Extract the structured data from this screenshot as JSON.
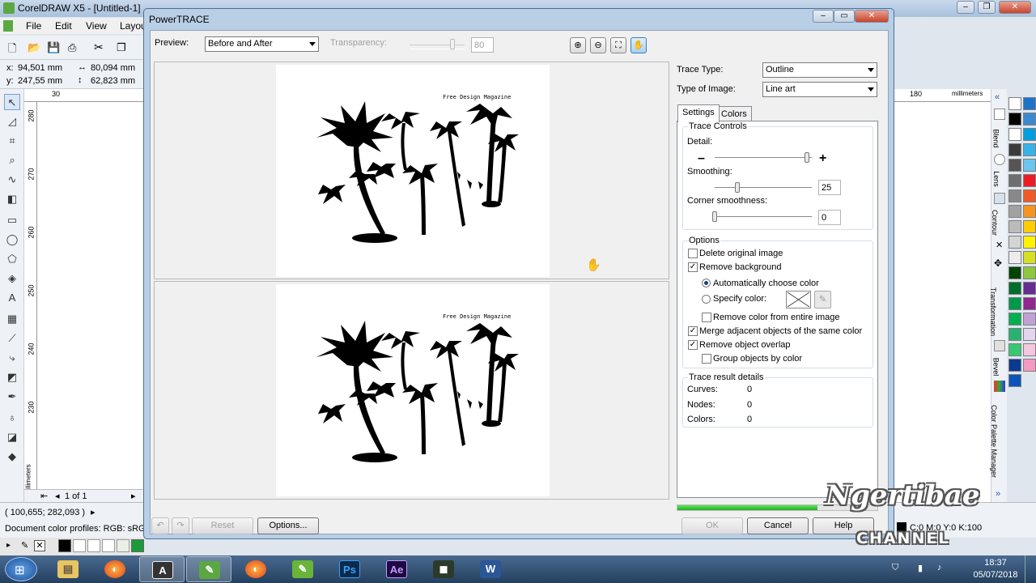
{
  "corel": {
    "title": "CorelDRAW X5 - [Untitled-1]",
    "menu": [
      "File",
      "Edit",
      "View",
      "Layou"
    ],
    "x_label": "x:",
    "x_value": "94,501 mm",
    "y_label": "y:",
    "y_value": "247,55 mm",
    "w_value": "80,094 mm",
    "h_value": "62,823 mm",
    "ruler_top": [
      "30",
      "180"
    ],
    "ruler_units": "millimeters",
    "ruler_left": [
      "280",
      "270",
      "260",
      "250",
      "240",
      "230"
    ],
    "ruler_left_units": "millimeters",
    "page_indicator": "1 of 1",
    "cursor_coords": "( 100,655; 282,093 )",
    "color_profile": "Document color profiles: RGB: sRGB IE",
    "fill_status": "C:0 M:0 Y:0 K:100",
    "dockers": [
      "Blend",
      "Lens",
      "Contour",
      "Transformation",
      "Bevel",
      "Color Palette Manager"
    ],
    "palette": [
      "#ffffff",
      "#000000",
      "#ffffff",
      "#3b3b3b",
      "#555555",
      "#6f6f6f",
      "#888888",
      "#a1a1a1",
      "#bbbbbb",
      "#d4d4d4",
      "#ececec",
      "#004400",
      "#006d2c",
      "#00984a",
      "#00b050",
      "#27b36f",
      "#37c871",
      "#0a3b8f",
      "#0b55b9",
      "#1e73c8",
      "#3b8ad1",
      "#00a0e0",
      "#38b3e8",
      "#6dc4ee",
      "#ed1c24",
      "#f15a24",
      "#f7941d",
      "#ffcc00",
      "#fff200",
      "#d7df23",
      "#8dc63f",
      "#662d91",
      "#92278f",
      "#c2a0d4",
      "#e4d4ef",
      "#f5c6dd",
      "#f49ac1"
    ]
  },
  "dialog": {
    "title": "PowerTRACE",
    "preview_label": "Preview:",
    "preview_value": "Before and After",
    "transparency_label": "Transparency:",
    "transparency_value": "80",
    "magazine_text": "Free Design Magazine",
    "trace_type_label": "Trace Type:",
    "trace_type_value": "Outline",
    "image_type_label": "Type of Image:",
    "image_type_value": "Line art",
    "tabs": [
      "Settings",
      "Colors"
    ],
    "trace_controls_title": "Trace Controls",
    "detail_label": "Detail:",
    "detail_level": 0.95,
    "smoothing_label": "Smoothing:",
    "smoothing_value": "25",
    "corner_label": "Corner smoothness:",
    "corner_value": "0",
    "options_title": "Options",
    "delete_original": "Delete original image",
    "delete_original_checked": false,
    "remove_background": "Remove background",
    "remove_background_checked": true,
    "auto_color": "Automatically choose color",
    "auto_color_selected": true,
    "specify_color": "Specify color:",
    "specify_color_selected": false,
    "remove_entire": "Remove color from entire image",
    "remove_entire_checked": false,
    "merge_adjacent": "Merge adjacent objects of the same color",
    "merge_adjacent_checked": true,
    "remove_overlap": "Remove object overlap",
    "remove_overlap_checked": true,
    "group_by_color": "Group objects by color",
    "group_by_color_checked": false,
    "result_title": "Trace result details",
    "curves_label": "Curves:",
    "curves_value": "0",
    "nodes_label": "Nodes:",
    "nodes_value": "0",
    "colors_label": "Colors:",
    "colors_value": "0",
    "progress": 0.7,
    "reset_label": "Reset",
    "options_label": "Options...",
    "ok_label": "OK",
    "cancel_label": "Cancel",
    "help_label": "Help"
  },
  "taskbar": {
    "time": "18:37",
    "date": "05/07/2018",
    "apps": [
      "windows-start",
      "file-explorer",
      "firefox",
      "coreldraw-a",
      "coreldraw-x5",
      "firefox-2",
      "corel-photo",
      "photoshop",
      "after-effects",
      "camtasia",
      "word"
    ],
    "ps_label": "Ps",
    "ae_label": "Ae",
    "a_label": "A"
  },
  "watermark": {
    "line1": "Ngertibae",
    "line2": "CHANNEL"
  }
}
